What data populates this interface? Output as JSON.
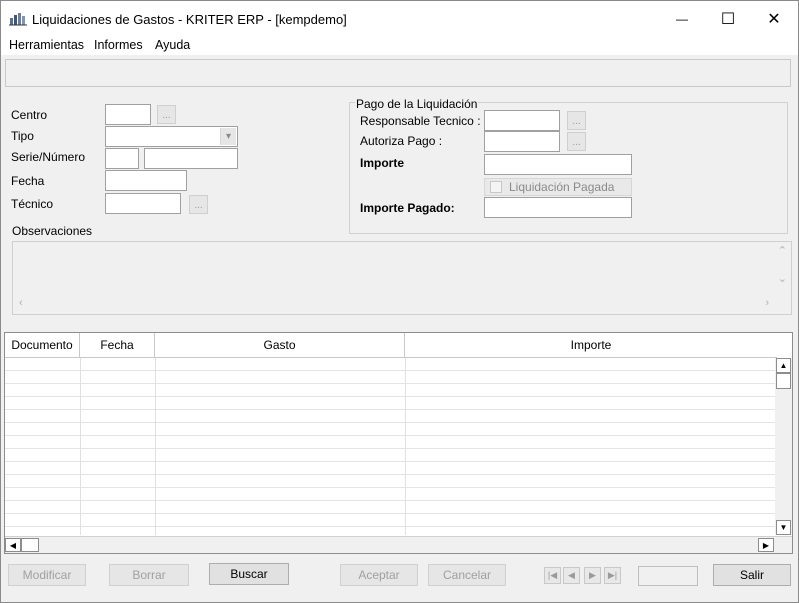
{
  "window": {
    "title": "Liquidaciones de Gastos - KRITER ERP - [kempdemo]",
    "minimize_glyph": "—",
    "maximize_glyph": "☐",
    "close_glyph": "✕"
  },
  "menu": [
    "Herramientas",
    "Informes",
    "Ayuda"
  ],
  "form": {
    "centro_label": "Centro",
    "centro_value": "",
    "tipo_label": "Tipo",
    "tipo_value": "",
    "serie_numero_label": "Serie/Número",
    "serie_value": "",
    "numero_value": "",
    "fecha_label": "Fecha",
    "fecha_value": "",
    "tecnico_label": "Técnico",
    "tecnico_value": "",
    "observaciones_label": "Observaciones",
    "observaciones_value": "",
    "ellipsis": "..."
  },
  "pago": {
    "group_title": "Pago de la Liquidación",
    "responsable_label": "Responsable Tecnico :",
    "responsable_value": "",
    "autoriza_label": "Autoriza Pago :",
    "autoriza_value": "",
    "importe_label": "Importe",
    "importe_value": "",
    "liquidacion_pagada_label": "Liquidación Pagada",
    "liquidacion_pagada_checked": false,
    "importe_pagado_label": "Importe Pagado:",
    "importe_pagado_value": ""
  },
  "grid": {
    "columns": [
      "Documento",
      "Fecha",
      "Gasto",
      "Importe"
    ],
    "rows": []
  },
  "buttons": {
    "modificar": "Modificar",
    "borrar": "Borrar",
    "buscar": "Buscar",
    "aceptar": "Aceptar",
    "cancelar": "Cancelar",
    "salir": "Salir"
  },
  "icons": {
    "app": "app-logo-icon",
    "combo_arrow": "chevron-down-icon",
    "nav_first": "first-record-icon",
    "nav_prev": "previous-record-icon",
    "nav_next": "next-record-icon",
    "nav_last": "last-record-icon"
  }
}
